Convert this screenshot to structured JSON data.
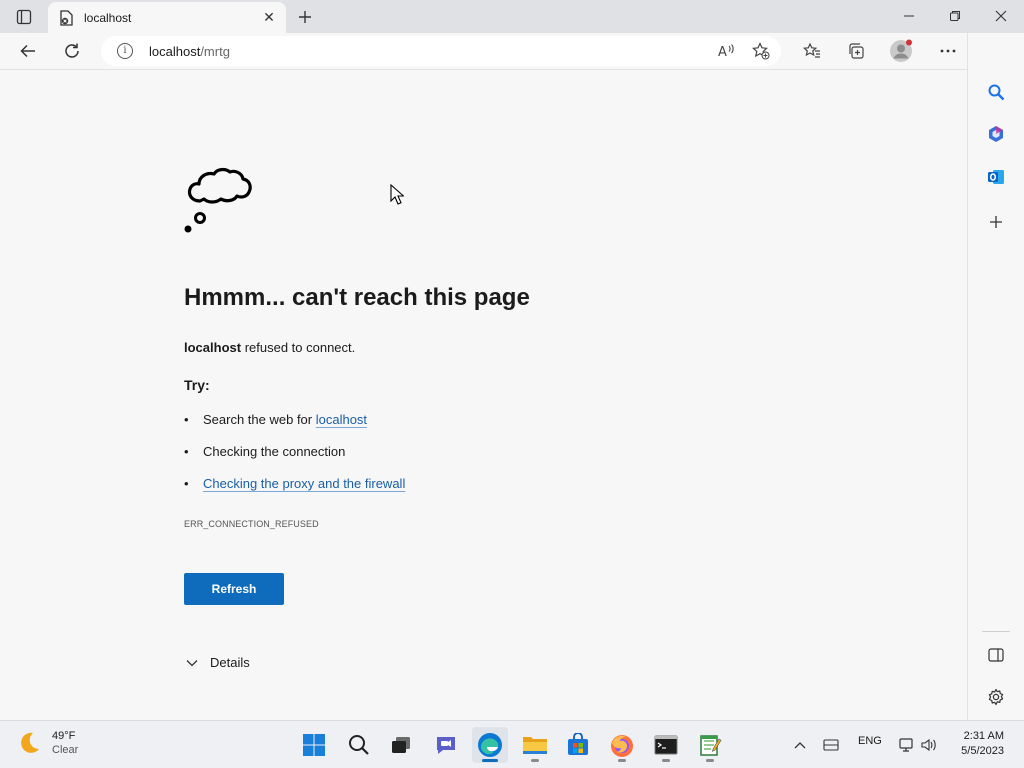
{
  "browser": {
    "tab_title": "localhost",
    "url_host": "localhost",
    "url_path": "/mrtg"
  },
  "page": {
    "heading": "Hmmm... can't reach this page",
    "host": "localhost",
    "refused_text": " refused to connect.",
    "try_label": "Try:",
    "suggestion_search_prefix": "Search the web for ",
    "suggestion_search_link": "localhost",
    "suggestion_connection": "Checking the connection",
    "suggestion_proxy": "Checking the proxy and the firewall",
    "error_code": "ERR_CONNECTION_REFUSED",
    "refresh_label": "Refresh",
    "details_label": "Details"
  },
  "taskbar": {
    "temperature": "49°F",
    "condition": "Clear",
    "language": "ENG",
    "time": "2:31 AM",
    "date": "5/5/2023"
  },
  "colors": {
    "accent": "#0f6cbd",
    "link": "#1a5ea6"
  }
}
